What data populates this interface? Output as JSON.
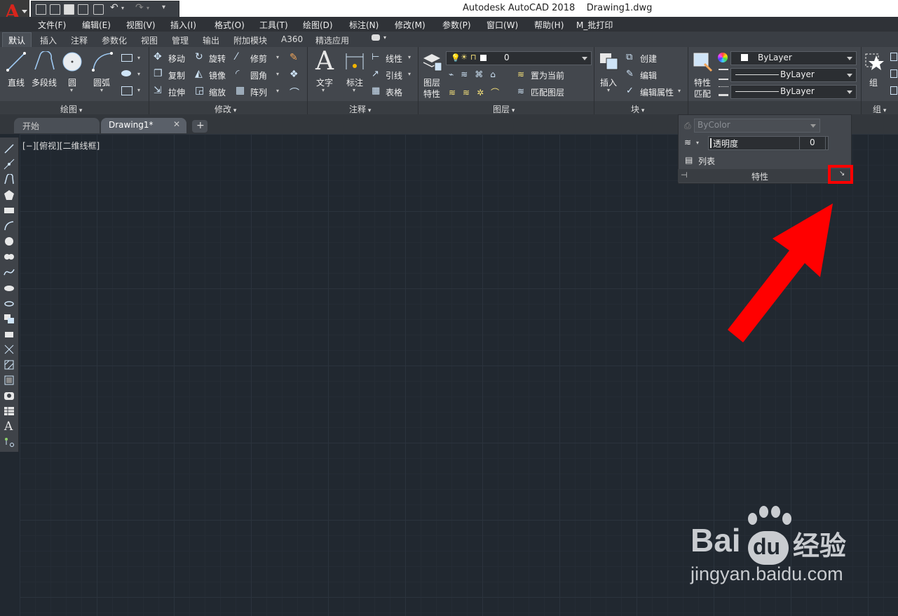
{
  "title_bar": {
    "app_name": "Autodesk AutoCAD 2018",
    "document": "Drawing1.dwg"
  },
  "app_button": {
    "letter": "A"
  },
  "menu": [
    "文件(F)",
    "编辑(E)",
    "视图(V)",
    "插入(I)",
    "格式(O)",
    "工具(T)",
    "绘图(D)",
    "标注(N)",
    "修改(M)",
    "参数(P)",
    "窗口(W)",
    "帮助(H)",
    "M_批打印"
  ],
  "ribbon_tabs": [
    "默认",
    "插入",
    "注释",
    "参数化",
    "视图",
    "管理",
    "输出",
    "附加模块",
    "A360",
    "精选应用"
  ],
  "panels": {
    "draw": {
      "title": "绘图",
      "line": "直线",
      "polyline": "多段线",
      "circle": "圆",
      "arc": "圆弧"
    },
    "modify": {
      "title": "修改",
      "move": "移动",
      "rotate": "旋转",
      "trim": "修剪",
      "copy": "复制",
      "mirror": "镜像",
      "fillet": "圆角",
      "stretch": "拉伸",
      "scale": "缩放",
      "array": "阵列"
    },
    "annotation": {
      "title": "注释",
      "text": "文字",
      "dimension": "标注",
      "linear": "线性",
      "leader": "引线",
      "table": "表格"
    },
    "layers": {
      "title": "图层",
      "layer_props_line1": "图层",
      "layer_props_line2": "特性",
      "current_layer": "0",
      "set_current": "置为当前",
      "match_layer": "匹配图层"
    },
    "block": {
      "title": "块",
      "insert": "插入",
      "create": "创建",
      "edit": "编辑",
      "edit_attr": "编辑属性"
    },
    "properties": {
      "title": "特性",
      "match_line1": "特性",
      "match_line2": "匹配",
      "color": "ByLayer",
      "linetype": "ByLayer",
      "lineweight": "ByLayer",
      "plot_style": "ByColor",
      "transparency_label": "透明度",
      "transparency_value": "0",
      "list": "列表"
    },
    "groups": {
      "title": "组",
      "group": "组"
    }
  },
  "doc_tabs": {
    "start": "开始",
    "drawing": "Drawing1*",
    "new": "+"
  },
  "viewport_label": "[−][俯视][二维线框]",
  "watermark": {
    "brand": "Bai",
    "brand2": "du",
    "suffix": "经验",
    "url": "jingyan.baidu.com"
  },
  "colors": {
    "highlight": "#ff0000",
    "canvas": "#212830",
    "accent_red": "#d9251c"
  }
}
